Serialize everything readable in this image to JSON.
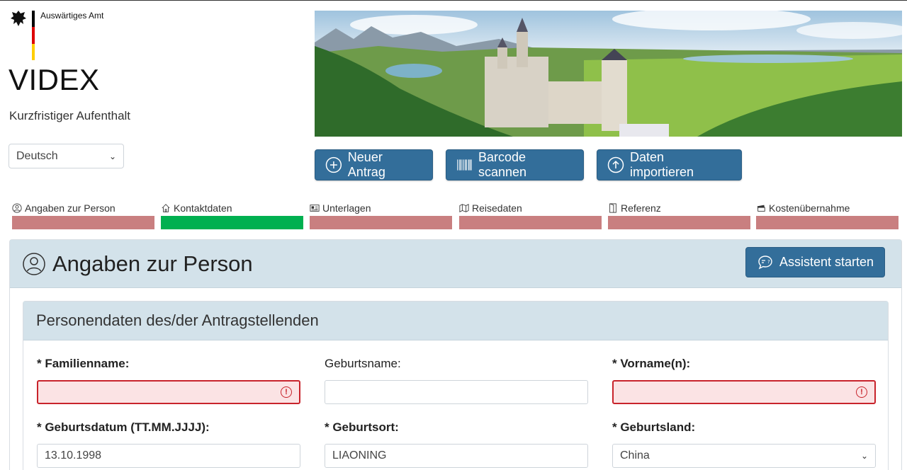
{
  "header": {
    "org_name": "Auswärtiges Amt",
    "app_title": "VIDEX",
    "app_subtitle": "Kurzfristiger Aufenthalt",
    "language": "Deutsch"
  },
  "actions": {
    "new_label": "Neuer Antrag",
    "scan_label": "Barcode scannen",
    "import_label": "Daten importieren"
  },
  "steps": [
    {
      "label": "Angaben zur Person",
      "status": "incomplete"
    },
    {
      "label": "Kontaktdaten",
      "status": "complete"
    },
    {
      "label": "Unterlagen",
      "status": "incomplete"
    },
    {
      "label": "Reisedaten",
      "status": "incomplete"
    },
    {
      "label": "Referenz",
      "status": "incomplete"
    },
    {
      "label": "Kostenübernahme",
      "status": "incomplete"
    }
  ],
  "section": {
    "title": "Angaben zur Person",
    "assistant_label": "Assistent starten",
    "subsection_title": "Personendaten des/der Antragstellenden"
  },
  "fields": {
    "familienname": {
      "label": "* Familienname:",
      "value": ""
    },
    "geburtsname": {
      "label": "Geburtsname:",
      "value": ""
    },
    "vorname": {
      "label": "* Vorname(n):",
      "value": ""
    },
    "geburtsdatum": {
      "label": "* Geburtsdatum (TT.MM.JJJJ):",
      "value": "13.10.1998"
    },
    "geburtsort": {
      "label": "* Geburtsort:",
      "value": "LIAONING"
    },
    "geburtsland": {
      "label": "* Geburtsland:",
      "value": "China"
    }
  },
  "colors": {
    "primary": "#336e9a",
    "step_incomplete": "#c97f80",
    "step_complete": "#00b050",
    "error": "#c8232b"
  }
}
